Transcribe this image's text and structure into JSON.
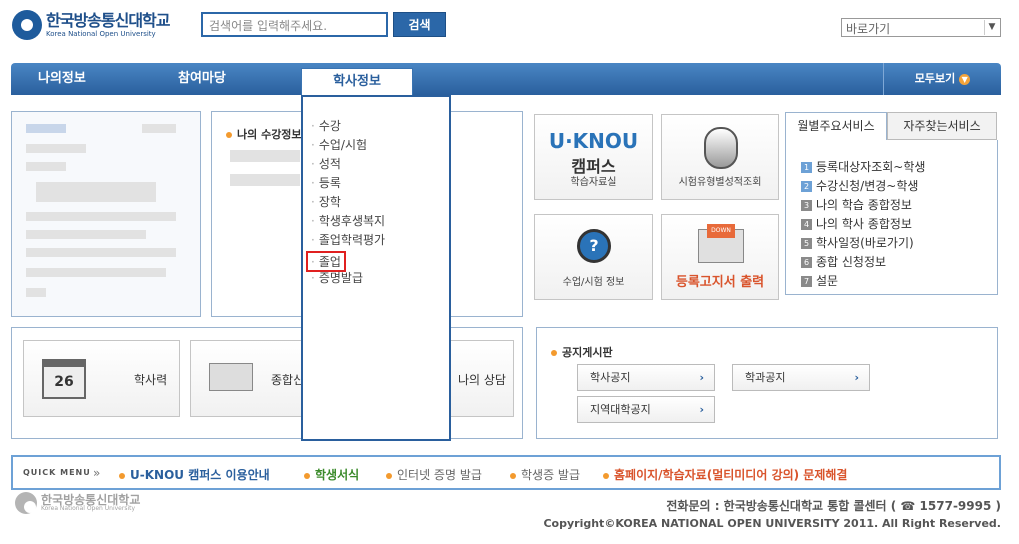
{
  "header": {
    "logo_ko": "한국방송통신대학교",
    "logo_en": "Korea National Open University",
    "search_placeholder": "검색어를 입력해주세요.",
    "search_button": "검색",
    "goto_select": "바로가기"
  },
  "nav": {
    "items": [
      "나의정보",
      "참여마당",
      "학사정보"
    ],
    "active": "학사정보",
    "all_view": "모두보기"
  },
  "left_panel": {
    "my_courses_title": "나의 수강정보"
  },
  "dropdown": {
    "items": [
      "수강",
      "수업/시험",
      "성적",
      "등록",
      "장학",
      "학생후생복지",
      "졸업학력평가",
      "졸업",
      "증명발급"
    ],
    "highlighted": "졸업"
  },
  "tiles": [
    {
      "logo": "U·KNOU",
      "logo_sub": "캠퍼스",
      "label": "학습자료실"
    },
    {
      "label": "시험유형별성적조회"
    },
    {
      "label": "수업/시험 정보"
    },
    {
      "label": "등록고지서 출력",
      "badge": "DOWN"
    }
  ],
  "services": {
    "tab_active": "월별주요서비스",
    "tab_inactive": "자주찾는서비스",
    "items": [
      {
        "n": "1",
        "text": "등록대상자조회~학생"
      },
      {
        "n": "2",
        "text": "수강신청/변경~학생"
      },
      {
        "n": "3",
        "text": "나의 학습 종합정보"
      },
      {
        "n": "4",
        "text": "나의 학사 종합정보"
      },
      {
        "n": "5",
        "text": "학사일정(바로가기)"
      },
      {
        "n": "6",
        "text": "종합 신청정보"
      },
      {
        "n": "7",
        "text": "설문"
      }
    ]
  },
  "shortcuts": {
    "calendar": "학사력",
    "calendar_num": "26",
    "search_label": "종합신",
    "counsel": "나의 상담"
  },
  "notice": {
    "title": "공지게시판",
    "buttons": [
      "학사공지",
      "학과공지",
      "지역대학공지"
    ]
  },
  "quick_menu": {
    "label": "QUICK MENU",
    "arrow": "»",
    "items": [
      "U-KNOU 캠퍼스 이용안내",
      "학생서식",
      "인터넷 증명 발급",
      "학생증 발급",
      "홈페이지/학습자료(멀티미디어 강의) 문제해결"
    ]
  },
  "footer": {
    "logo_ko": "한국방송통신대학교",
    "logo_en": "Korea National Open University",
    "contact": "전화문의 : 한국방송통신대학교 통합 콜센터 ( ☎ 1577-9995 )",
    "copyright": "Copyright©KOREA NATIONAL OPEN UNIVERSITY 2011. All Right Reserved."
  }
}
